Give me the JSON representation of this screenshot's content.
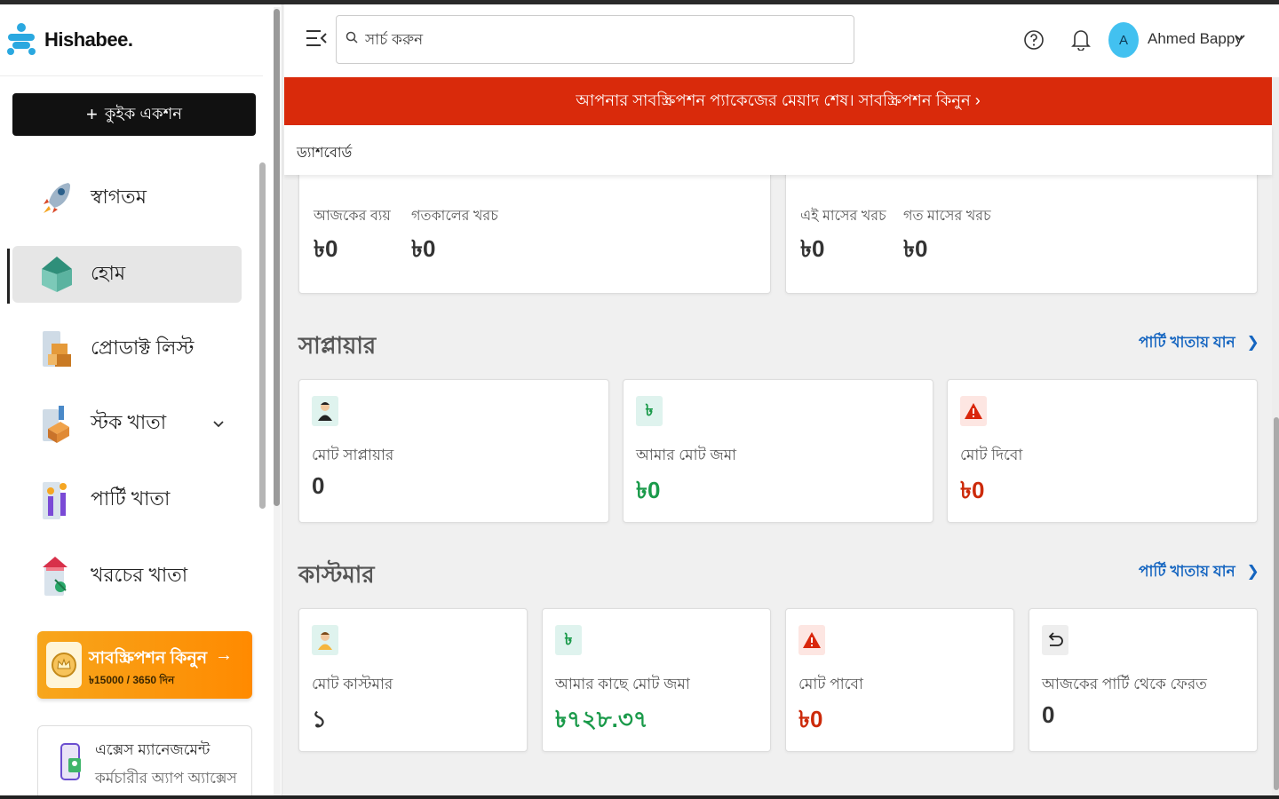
{
  "app": {
    "name": "Hishabee."
  },
  "sidebar": {
    "quick_action": "কুইক একশন",
    "items": [
      {
        "label": "স্বাগতম",
        "icon": "rocket-icon"
      },
      {
        "label": "হোম",
        "icon": "home-icon"
      },
      {
        "label": "প্রোডাক্ট লিস্ট",
        "icon": "boxes-icon"
      },
      {
        "label": "স্টক খাতা",
        "icon": "stock-icon"
      },
      {
        "label": "পার্টি খাতা",
        "icon": "party-icon"
      },
      {
        "label": "খরচের খাতা",
        "icon": "expense-icon"
      }
    ],
    "subscription": {
      "title": "সাবস্ক্রিপশন কিনুন",
      "price": "৳15000 / 3650 দিন"
    },
    "access": {
      "line1": "এক্সেস ম্যানেজমেন্ট",
      "line2": "কর্মচারীর অ্যাপ অ্যাক্সেস"
    }
  },
  "header": {
    "search_placeholder": "সার্চ করুন",
    "user_initial": "A",
    "user_name": "Ahmed Bappy"
  },
  "banner": {
    "text": "আপনার সাবস্ক্রিপশন প্যাকেজের মেয়াদ শেষ। সাবস্ক্রিপশন কিনুন ›"
  },
  "breadcrumb": "ড্যাশবোর্ড",
  "expenses": {
    "today_label": "আজকের ব্যয়",
    "today_value": "৳0",
    "yesterday_label": "গতকালের খরচ",
    "yesterday_value": "৳0",
    "month_label": "এই মাসের খরচ",
    "month_value": "৳0",
    "last_month_label": "গত মাসের খরচ",
    "last_month_value": "৳0"
  },
  "supplier": {
    "title": "সাপ্লায়ার",
    "link": "পার্টি খাতায় যান",
    "cards": [
      {
        "label": "মোট সাপ্লায়ার",
        "value": "0"
      },
      {
        "label": "আমার মোট জমা",
        "value": "৳0"
      },
      {
        "label": "মোট দিবো",
        "value": "৳0"
      }
    ]
  },
  "customer": {
    "title": "কাস্টমার",
    "link": "পার্টি খাতায় যান",
    "cards": [
      {
        "label": "মোট কাস্টমার",
        "value": "১"
      },
      {
        "label": "আমার কাছে মোট জমা",
        "value": "৳৭২৮.৩৭"
      },
      {
        "label": "মোট পাবো",
        "value": "৳0"
      },
      {
        "label": "আজকের পার্টি থেকে ফেরত",
        "value": "0"
      }
    ]
  },
  "colors": {
    "banner": "#d92a0b",
    "link": "#1565c0",
    "green": "#1a9a4a",
    "red": "#cc2a0a",
    "accent": "#f7a61c"
  }
}
